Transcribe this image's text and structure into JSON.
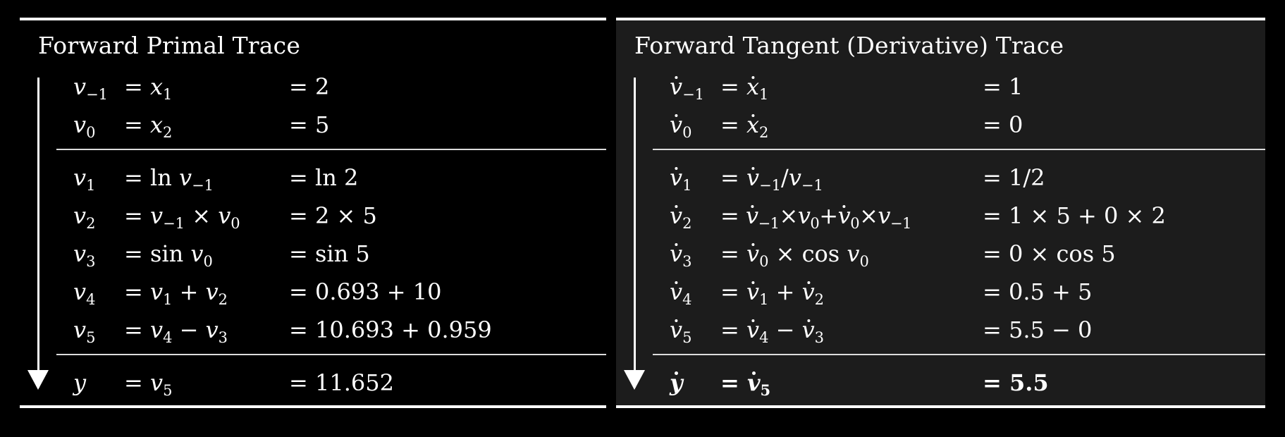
{
  "primal": {
    "title": "Forward Primal Trace",
    "rows": [
      {
        "col3": "= 2"
      },
      {
        "col3": "= 5"
      },
      {
        "col3": "= ln 2"
      },
      {
        "col3": "= 2 × 5"
      },
      {
        "col3": "= sin 5"
      },
      {
        "col3": "= 0.693 + 10"
      },
      {
        "col3": "= 10.693 + 0.959"
      },
      {
        "col3": "= 11.652"
      }
    ]
  },
  "tangent": {
    "title": "Forward Tangent (Derivative) Trace",
    "rows": [
      {
        "col3": "= 1"
      },
      {
        "col3": "= 0"
      },
      {
        "col3": "= 1/2"
      },
      {
        "col3": "= 1 × 5 + 0 × 2"
      },
      {
        "col3": "= 0 × cos 5"
      },
      {
        "col3": "= 0.5 + 5"
      },
      {
        "col3": "= 5.5 − 0"
      },
      {
        "col3": "= 5.5"
      }
    ]
  },
  "colors": {
    "background": "#000000",
    "tangent_panel": "#1c1c1c",
    "foreground": "#ffffff"
  },
  "icons": {
    "flow_arrow": "down-arrow-icon"
  }
}
